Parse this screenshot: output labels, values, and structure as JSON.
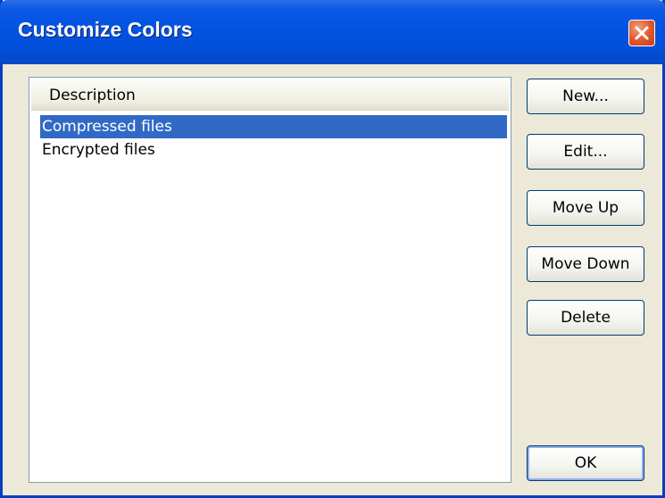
{
  "window": {
    "title": "Customize Colors"
  },
  "list": {
    "column_header": "Description",
    "items": [
      {
        "label": "Compressed files",
        "selected": true
      },
      {
        "label": "Encrypted files",
        "selected": false
      }
    ]
  },
  "buttons": {
    "new_label": "New...",
    "edit_label": "Edit...",
    "move_up_label": "Move Up",
    "move_down_label": "Move Down",
    "delete_label": "Delete",
    "ok_label": "OK"
  },
  "colors": {
    "titlebar": "#0554e2",
    "selection": "#316ac5",
    "close": "#e0552a",
    "dialog_bg": "#ece9d8"
  }
}
